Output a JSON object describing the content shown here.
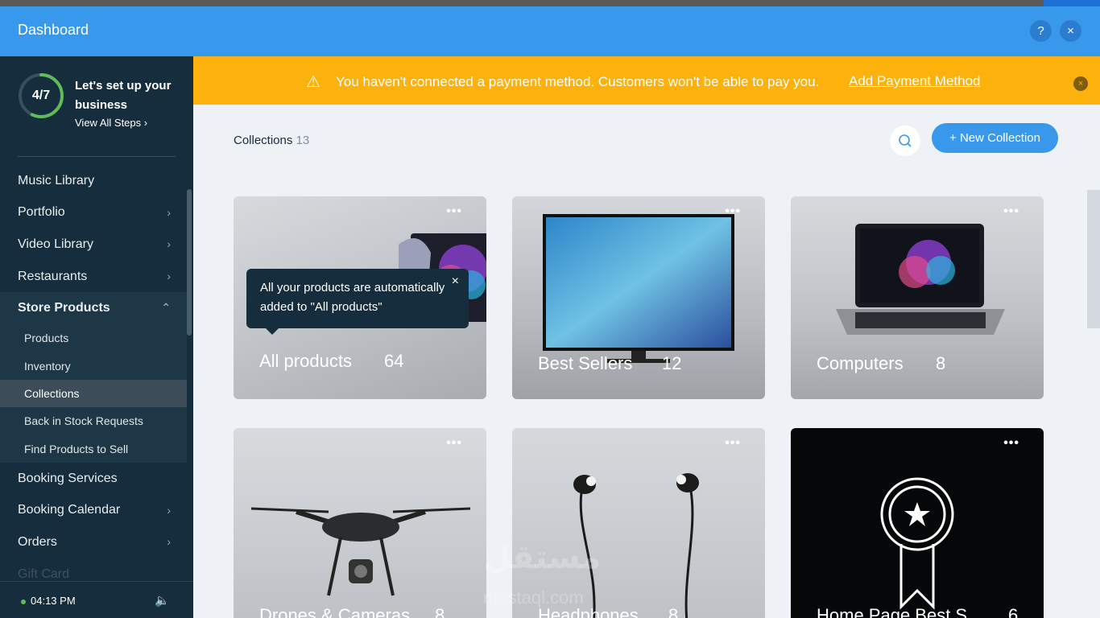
{
  "window": {
    "title": "Dashboard",
    "help_label": "?",
    "close_label": "×"
  },
  "setup": {
    "progress_label": "4/7",
    "progress": 0.57,
    "title": "Let's set up your business",
    "link": "View All Steps ›"
  },
  "nav": {
    "music_library": "Music Library",
    "portfolio": "Portfolio",
    "video_library": "Video Library",
    "restaurants": "Restaurants",
    "store_products": "Store Products",
    "sub": {
      "products": "Products",
      "inventory": "Inventory",
      "collections": "Collections",
      "back_in_stock": "Back in Stock Requests",
      "find_products": "Find Products to Sell"
    },
    "booking_services": "Booking Services",
    "booking_calendar": "Booking Calendar",
    "orders": "Orders",
    "gift_card": "Gift Card"
  },
  "footer": {
    "time": "04:13 PM"
  },
  "banner": {
    "message": "You haven't connected a payment method. Customers won't be able to pay you.",
    "link": "Add Payment Method",
    "close_label": "×"
  },
  "collections": {
    "title": "Collections",
    "count": "13",
    "new_button": "+ New Collection",
    "items": [
      {
        "name": "All products",
        "count": "64"
      },
      {
        "name": "Best Sellers",
        "count": "12"
      },
      {
        "name": "Computers",
        "count": "8"
      },
      {
        "name": "Drones & Cameras",
        "count": "8"
      },
      {
        "name": "Headphones",
        "count": "8"
      },
      {
        "name": "Home Page Best S...",
        "count": "6"
      }
    ]
  },
  "tooltip": {
    "text": "All your products are automatically added to \"All products\"",
    "close_label": "×"
  },
  "watermark": {
    "logo": "مستقل",
    "url": "mostaql.com"
  },
  "colors": {
    "header": "#3899ec",
    "sidebar": "#162d3d",
    "banner": "#fdb10c",
    "accent": "#3899ec"
  }
}
